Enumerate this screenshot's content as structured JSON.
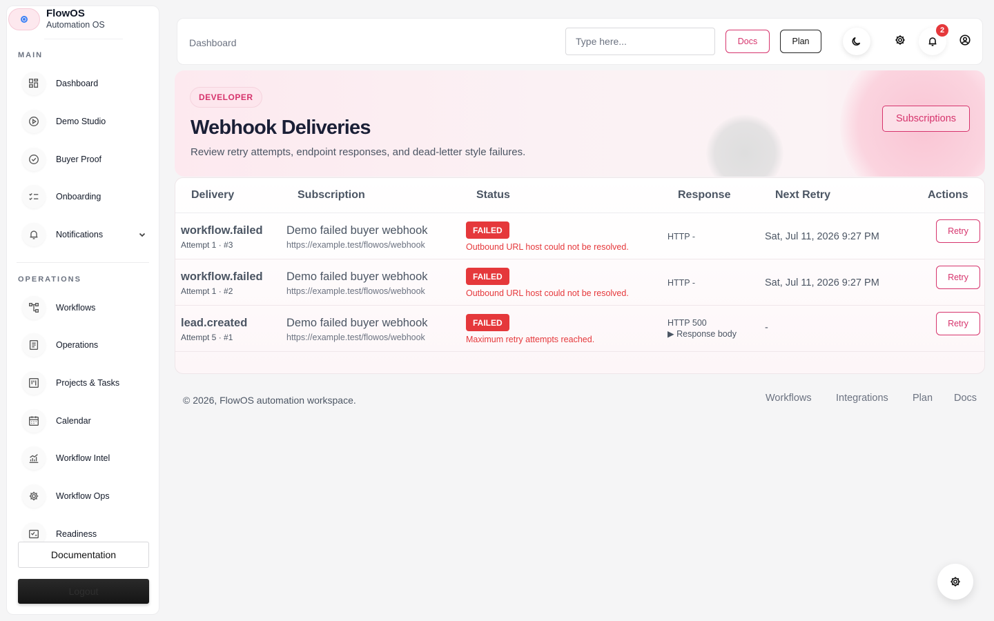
{
  "brand": {
    "name": "FlowOS",
    "subtitle": "Automation OS"
  },
  "sidebar": {
    "main_title": "MAIN",
    "operations_title": "OPERATIONS",
    "main_items": [
      {
        "label": "Dashboard",
        "icon": "dashboard-icon"
      },
      {
        "label": "Demo Studio",
        "icon": "play-circle-icon"
      },
      {
        "label": "Buyer Proof",
        "icon": "check-circle-icon"
      },
      {
        "label": "Onboarding",
        "icon": "checklist-icon"
      },
      {
        "label": "Notifications",
        "icon": "bell-icon"
      }
    ],
    "operations_items": [
      {
        "label": "Workflows",
        "icon": "workflow-icon"
      },
      {
        "label": "Operations",
        "icon": "document-icon"
      },
      {
        "label": "Projects & Tasks",
        "icon": "kanban-icon"
      },
      {
        "label": "Calendar",
        "icon": "calendar-icon"
      },
      {
        "label": "Workflow Intel",
        "icon": "chart-icon"
      },
      {
        "label": "Workflow Ops",
        "icon": "gear-icon"
      },
      {
        "label": "Readiness",
        "icon": "checklist-icon"
      }
    ],
    "documentation_label": "Documentation",
    "logout_label": "Logout"
  },
  "topbar": {
    "breadcrumb": "Dashboard",
    "search_placeholder": "Type here...",
    "docs_label": "Docs",
    "plan_label": "Plan",
    "notification_count": "2"
  },
  "hero": {
    "tag": "DEVELOPER",
    "title": "Webhook Deliveries",
    "subtitle": "Review retry attempts, endpoint responses, and dead-letter style failures.",
    "subscriptions_label": "Subscriptions"
  },
  "table": {
    "headers": [
      "Delivery",
      "Subscription",
      "Status",
      "Response",
      "Next Retry",
      "Actions"
    ],
    "rows": [
      {
        "delivery": "workflow.failed",
        "attempt": "Attempt 1 · #3",
        "subscription": "Demo failed buyer webhook",
        "url": "https://example.test/flowos/webhook",
        "status": "FAILED",
        "error": "Outbound URL host could not be resolved.",
        "response": "HTTP -",
        "response_detail": "",
        "next_retry": "Sat, Jul 11, 2026 9:27 PM",
        "action": "Retry"
      },
      {
        "delivery": "workflow.failed",
        "attempt": "Attempt 1 · #2",
        "subscription": "Demo failed buyer webhook",
        "url": "https://example.test/flowos/webhook",
        "status": "FAILED",
        "error": "Outbound URL host could not be resolved.",
        "response": "HTTP -",
        "response_detail": "",
        "next_retry": "Sat, Jul 11, 2026 9:27 PM",
        "action": "Retry"
      },
      {
        "delivery": "lead.created",
        "attempt": "Attempt 5 · #1",
        "subscription": "Demo failed buyer webhook",
        "url": "https://example.test/flowos/webhook",
        "status": "FAILED",
        "error": "Maximum retry attempts reached.",
        "response": "HTTP 500",
        "response_detail": "▶ Response body",
        "next_retry": "-",
        "action": "Retry"
      }
    ]
  },
  "footer": {
    "copyright": "© 2026, FlowOS automation workspace.",
    "links": [
      "Workflows",
      "Integrations",
      "Plan",
      "Docs"
    ]
  },
  "colors": {
    "accent": "#d6336c",
    "danger": "#e5383b"
  }
}
